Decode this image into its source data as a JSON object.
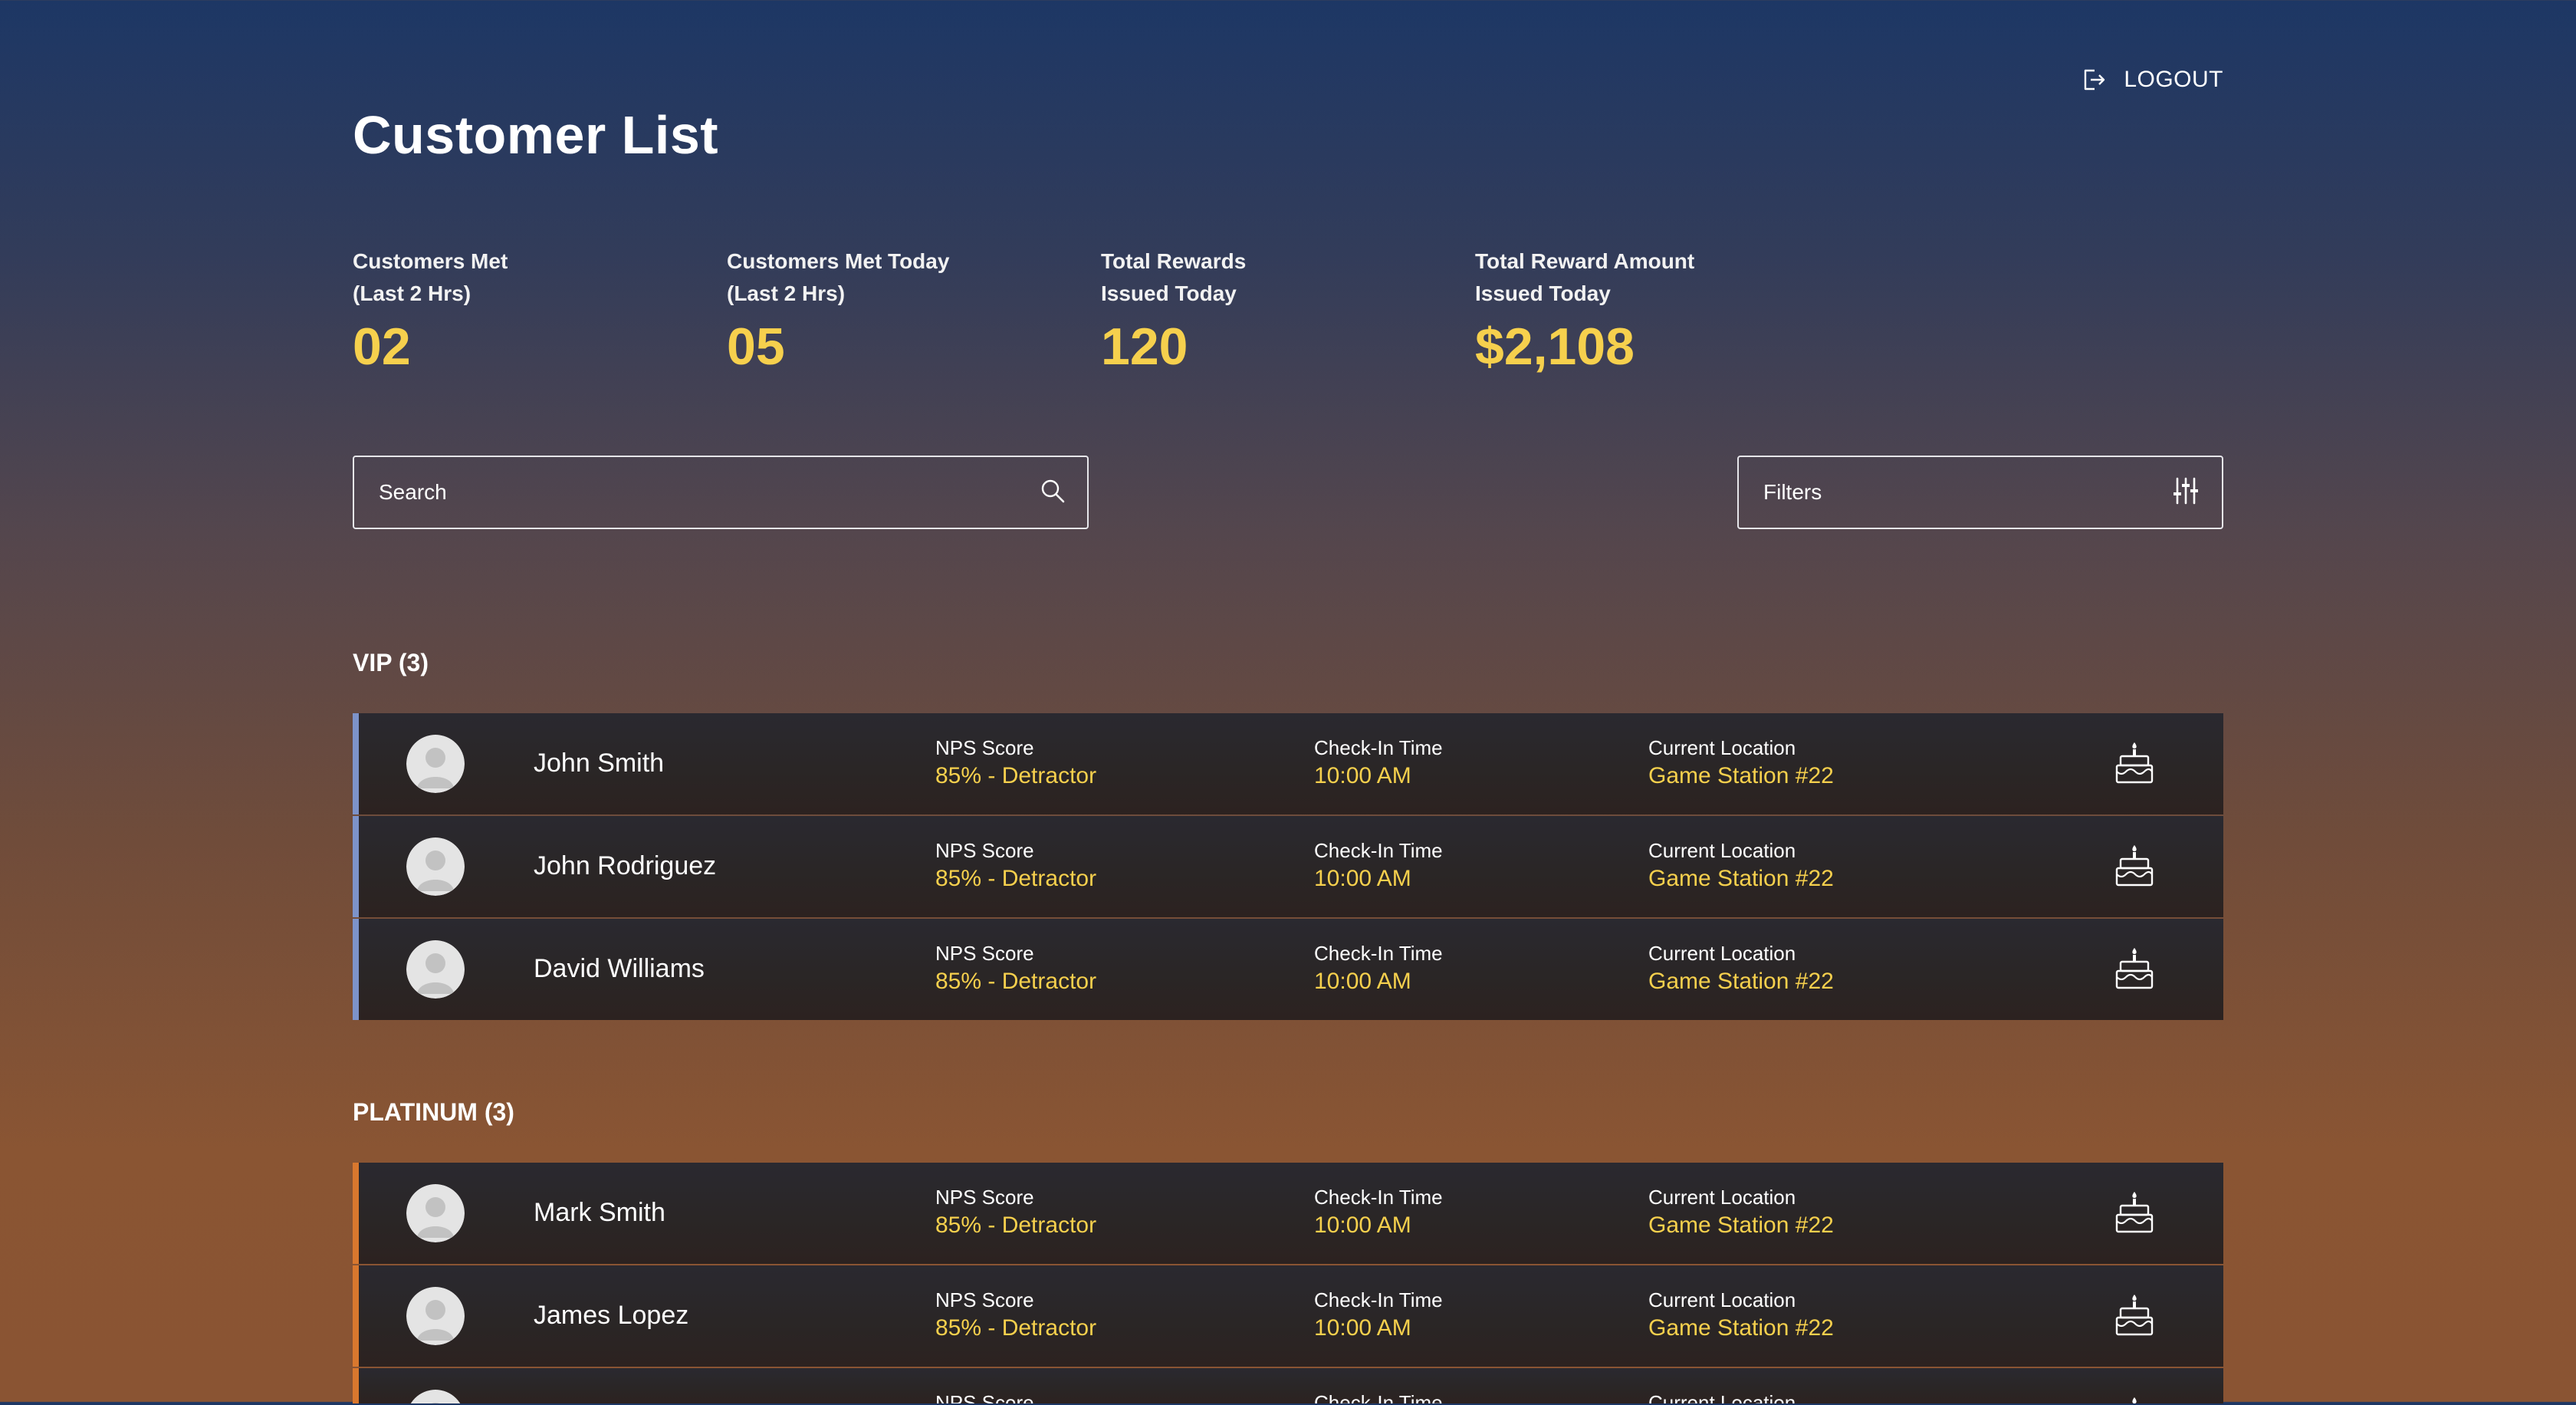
{
  "header": {
    "title": "Customer List",
    "logout_label": "LOGOUT"
  },
  "stats": [
    {
      "label_line1": "Customers Met",
      "label_line2": "(Last 2 Hrs)",
      "value": "02"
    },
    {
      "label_line1": "Customers Met Today",
      "label_line2": "(Last 2 Hrs)",
      "value": "05"
    },
    {
      "label_line1": "Total Rewards",
      "label_line2": "Issued Today",
      "value": "120"
    },
    {
      "label_line1": "Total Reward Amount",
      "label_line2": "Issued Today",
      "value": "$2,108"
    }
  ],
  "search": {
    "placeholder": "Search"
  },
  "filters": {
    "label": "Filters"
  },
  "field_labels": {
    "nps": "NPS Score",
    "checkin": "Check-In Time",
    "location": "Current Location"
  },
  "sections": [
    {
      "heading": "VIP (3)",
      "tier": "vip",
      "customers": [
        {
          "name": "John Smith",
          "nps": "85% - Detractor",
          "checkin": "10:00 AM",
          "location": "Game Station #22"
        },
        {
          "name": "John Rodriguez",
          "nps": "85% - Detractor",
          "checkin": "10:00 AM",
          "location": "Game Station #22"
        },
        {
          "name": "David Williams",
          "nps": "85% - Detractor",
          "checkin": "10:00 AM",
          "location": "Game Station #22"
        }
      ]
    },
    {
      "heading": "PLATINUM (3)",
      "tier": "platinum",
      "customers": [
        {
          "name": "Mark Smith",
          "nps": "85% - Detractor",
          "checkin": "10:00 AM",
          "location": "Game Station #22"
        },
        {
          "name": "James Lopez",
          "nps": "85% - Detractor",
          "checkin": "10:00 AM",
          "location": "Game Station #22"
        },
        {
          "name": "",
          "nps": "",
          "checkin": "",
          "location": ""
        }
      ]
    }
  ],
  "colors": {
    "accent_value": "#f6d04d",
    "vip_stripe": "#7d93c9",
    "platinum_stripe": "#d9782e"
  },
  "icons": {
    "logout": "logout-icon",
    "search": "search-icon",
    "filters": "sliders-icon",
    "avatar": "avatar-placeholder-icon",
    "birthday": "birthday-cake-icon"
  }
}
